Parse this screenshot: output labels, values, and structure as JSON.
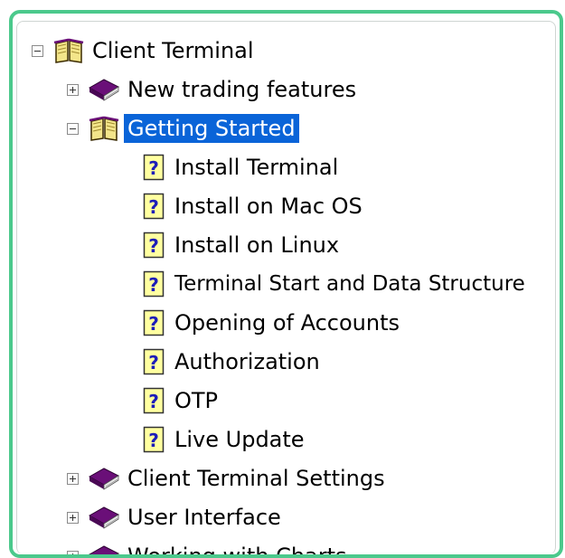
{
  "tree": {
    "root": {
      "label": "Client Terminal",
      "expanded": true
    },
    "nodes": [
      {
        "label": "New trading features",
        "type": "book",
        "expanded": false
      },
      {
        "label": "Getting Started",
        "type": "book",
        "expanded": true,
        "selected": true
      },
      {
        "label": "Install Terminal",
        "type": "page"
      },
      {
        "label": "Install on Mac OS",
        "type": "page"
      },
      {
        "label": "Install on Linux",
        "type": "page"
      },
      {
        "label": "Terminal Start and Data Structure",
        "type": "page"
      },
      {
        "label": "Opening of Accounts",
        "type": "page"
      },
      {
        "label": "Authorization",
        "type": "page"
      },
      {
        "label": "OTP",
        "type": "page"
      },
      {
        "label": "Live Update",
        "type": "page"
      },
      {
        "label": "Client Terminal Settings",
        "type": "book",
        "expanded": false
      },
      {
        "label": "User Interface",
        "type": "book",
        "expanded": false
      },
      {
        "label": "Working with Charts",
        "type": "book",
        "expanded": false
      }
    ]
  },
  "colors": {
    "frame_border": "#4bc98c",
    "selection": "#0a64d8",
    "book": "#6a0f78",
    "help_page_mark": "#1d1db8"
  }
}
